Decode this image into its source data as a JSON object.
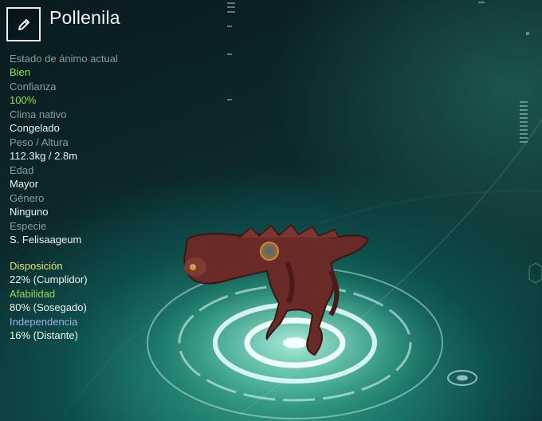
{
  "creature": {
    "name": "Pollenila"
  },
  "icons": {
    "edit": "pencil-icon"
  },
  "stats": [
    {
      "key": "mood",
      "label": "Estado de ánimo actual",
      "value": "Bien",
      "value_color": "green"
    },
    {
      "key": "trust",
      "label": "Confianza",
      "value": "100%",
      "value_color": "green"
    },
    {
      "key": "climate",
      "label": "Clima nativo",
      "value": "Congelado"
    },
    {
      "key": "weight-height",
      "label": "Peso / Altura",
      "value": "112.3kg / 2.8m"
    },
    {
      "key": "age",
      "label": "Edad",
      "value": "Mayor"
    },
    {
      "key": "gender",
      "label": "Género",
      "value": "Ninguno"
    },
    {
      "key": "species",
      "label": "Especie",
      "value": "S. Felisaageum"
    }
  ],
  "traits": [
    {
      "key": "disposition",
      "label": "Disposición",
      "value": "22% (Cumplidor)",
      "label_color": "#e6e27a"
    },
    {
      "key": "affability",
      "label": "Afabilidad",
      "value": "80% (Sosegado)",
      "label_color": "#9bd655"
    },
    {
      "key": "independence",
      "label": "Independencia",
      "value": "16% (Distante)",
      "label_color": "#9fb4e6"
    }
  ]
}
